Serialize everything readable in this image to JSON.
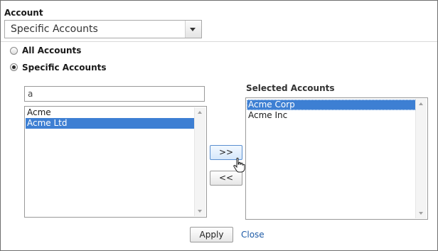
{
  "account": {
    "label": "Account",
    "dropdown_value": "Specific Accounts"
  },
  "radios": [
    {
      "label": "All Accounts",
      "checked": false
    },
    {
      "label": "Specific Accounts",
      "checked": true
    }
  ],
  "search": {
    "value": "a"
  },
  "available_list": {
    "items": [
      "Acme",
      "Acme Ltd"
    ],
    "selected_index": 1
  },
  "selected_list": {
    "heading": "Selected Accounts",
    "items": [
      "Acme Corp",
      "Acme Inc"
    ],
    "selected_index": 0
  },
  "buttons": {
    "add": ">>",
    "remove": "<<",
    "apply": "Apply",
    "close": "Close"
  },
  "colors": {
    "selection": "#3d7fd3",
    "link": "#1d5aa6"
  }
}
